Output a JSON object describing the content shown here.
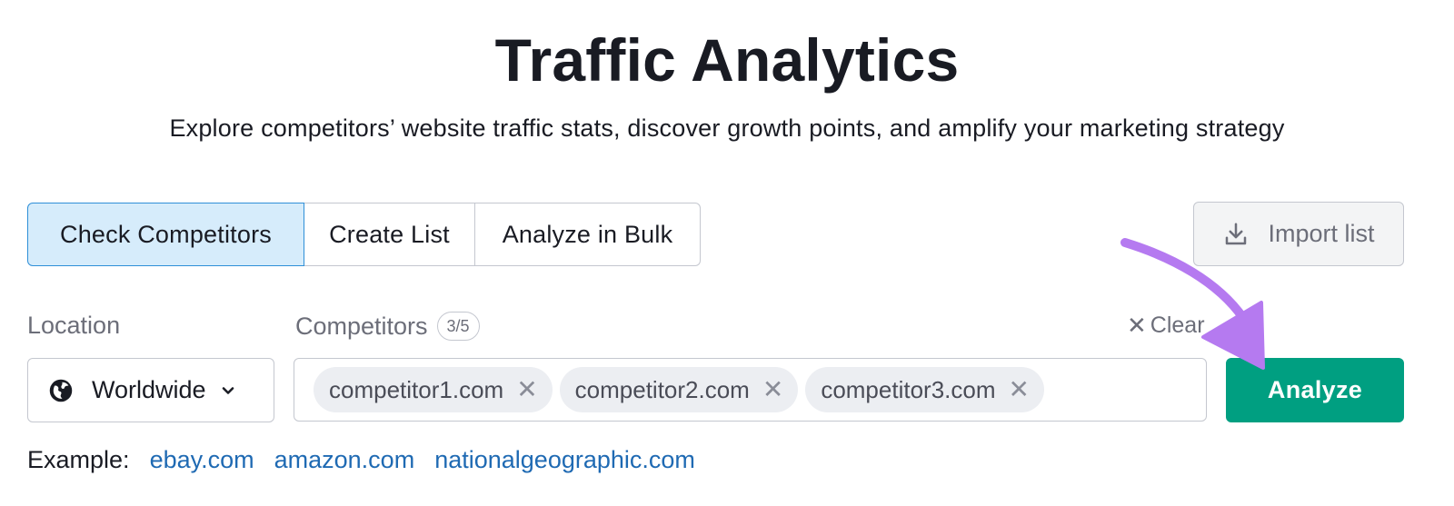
{
  "header": {
    "title": "Traffic Analytics",
    "subtitle": "Explore competitors’ website traffic stats, discover growth points, and amplify your marketing strategy"
  },
  "tabs": [
    {
      "label": "Check Competitors",
      "active": true
    },
    {
      "label": "Create List",
      "active": false
    },
    {
      "label": "Analyze in Bulk",
      "active": false
    }
  ],
  "import": {
    "label": "Import list",
    "icon": "download-icon"
  },
  "location": {
    "label": "Location",
    "value": "Worldwide",
    "icon": "globe-icon"
  },
  "competitors": {
    "label": "Competitors",
    "count": "3/5",
    "clear_label": "Clear",
    "chips": [
      "competitor1.com",
      "competitor2.com",
      "competitor3.com"
    ]
  },
  "analyze": {
    "label": "Analyze"
  },
  "examples": {
    "label": "Example:",
    "links": [
      "ebay.com",
      "amazon.com",
      "nationalgeographic.com"
    ]
  },
  "colors": {
    "primary_button": "#009f81",
    "active_tab_bg": "#d6ecfb",
    "active_tab_border": "#2f8fd8",
    "link": "#1f6ab3",
    "annotation_arrow": "#b57af0"
  }
}
